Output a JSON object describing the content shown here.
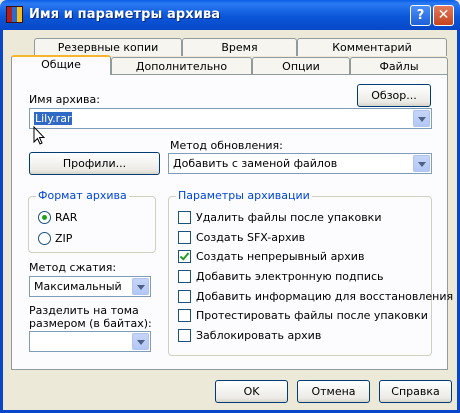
{
  "window": {
    "title": "Имя и параметры архива",
    "help_glyph": "?",
    "close_glyph": "✕"
  },
  "tabs_back": [
    "Резервные копии",
    "Время",
    "Комментарий"
  ],
  "tabs_front": [
    "Общие",
    "Дополнительно",
    "Опции",
    "Файлы"
  ],
  "active_tab": "Общие",
  "archive_name": {
    "label": "Имя архива:",
    "value": "Lily.rar",
    "browse_label": "Обзор..."
  },
  "update_method": {
    "label": "Метод обновления:",
    "value": "Добавить с заменой файлов"
  },
  "profiles_label": "Профили...",
  "format": {
    "title": "Формат архива",
    "options": [
      "RAR",
      "ZIP"
    ],
    "selected": "RAR"
  },
  "compression": {
    "label": "Метод сжатия:",
    "value": "Максимальный"
  },
  "split": {
    "label_line1": "Разделить на тома",
    "label_line2": "размером (в байтах):",
    "value": ""
  },
  "params": {
    "title": "Параметры архивации",
    "options": [
      {
        "label": "Удалить файлы после упаковки",
        "checked": false
      },
      {
        "label": "Создать SFX-архив",
        "checked": false
      },
      {
        "label": "Создать непрерывный архив",
        "checked": true
      },
      {
        "label": "Добавить электронную подпись",
        "checked": false
      },
      {
        "label": "Добавить информацию для восстановления",
        "checked": false
      },
      {
        "label": "Протестировать файлы после упаковки",
        "checked": false
      },
      {
        "label": "Заблокировать архив",
        "checked": false
      }
    ]
  },
  "buttons": {
    "ok": "OK",
    "cancel": "Отмена",
    "help": "Справка"
  }
}
